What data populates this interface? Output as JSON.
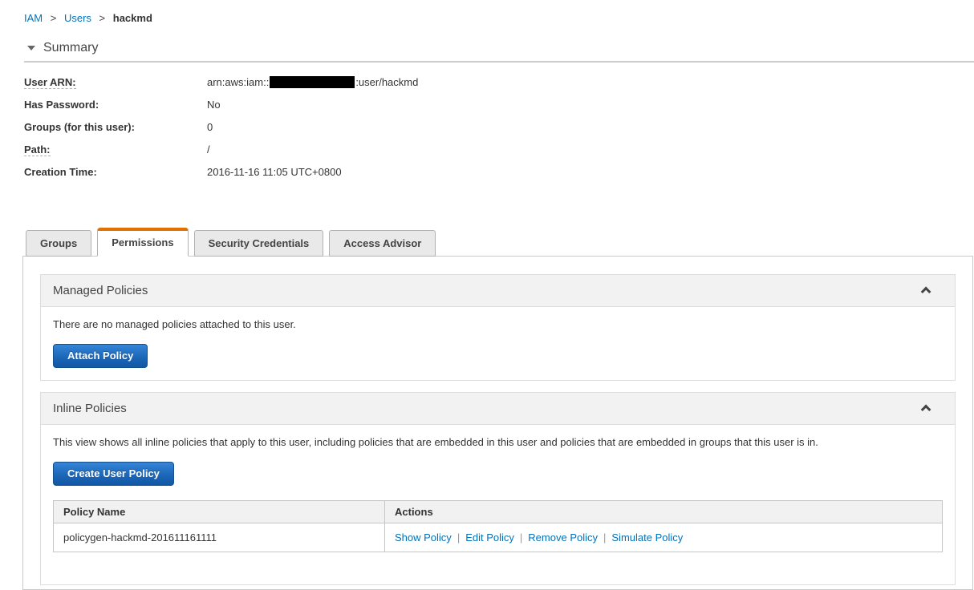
{
  "breadcrumb": {
    "separator": ">",
    "items": [
      {
        "label": "IAM"
      },
      {
        "label": "Users"
      },
      {
        "label": "hackmd"
      }
    ]
  },
  "summary": {
    "title": "Summary",
    "fields": [
      {
        "label": "User ARN:",
        "value_prefix": "arn:aws:iam::",
        "value_suffix": ":user/hackmd",
        "redacted": true,
        "tooltip": true
      },
      {
        "label": "Has Password:",
        "value": "No"
      },
      {
        "label": "Groups (for this user):",
        "value": "0"
      },
      {
        "label": "Path:",
        "value": "/",
        "tooltip": true
      },
      {
        "label": "Creation Time:",
        "value": "2016-11-16 11:05 UTC+0800"
      }
    ]
  },
  "tabs": [
    {
      "label": "Groups",
      "active": false
    },
    {
      "label": "Permissions",
      "active": true
    },
    {
      "label": "Security Credentials",
      "active": false
    },
    {
      "label": "Access Advisor",
      "active": false
    }
  ],
  "managed_policies": {
    "title": "Managed Policies",
    "empty_text": "There are no managed policies attached to this user.",
    "attach_button": "Attach Policy"
  },
  "inline_policies": {
    "title": "Inline Policies",
    "description": "This view shows all inline policies that apply to this user, including policies that are embedded in this user and policies that are embedded in groups that this user is in.",
    "create_button": "Create User Policy",
    "table": {
      "headers": [
        "Policy Name",
        "Actions"
      ],
      "action_separator": "|",
      "rows": [
        {
          "policy_name": "policygen-hackmd-201611161111",
          "actions": [
            "Show Policy",
            "Edit Policy",
            "Remove Policy",
            "Simulate Policy"
          ]
        }
      ]
    }
  },
  "icons": {
    "summary_collapse": "triangle-down",
    "section_collapse": "chevron-up"
  },
  "colors": {
    "link_blue": "#0073bb",
    "tab_active_accent": "#e17000",
    "button_blue_top": "#3585d8",
    "button_blue_bottom": "#1157a5",
    "section_header_bg": "#f2f2f2",
    "redaction": "#000000"
  }
}
